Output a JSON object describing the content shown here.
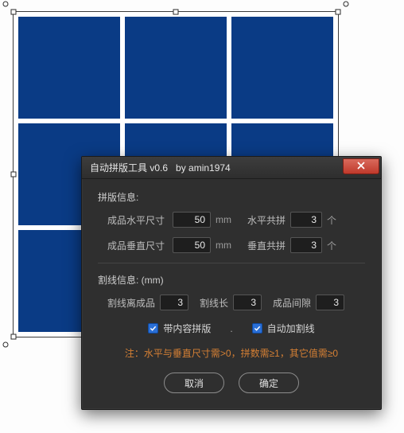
{
  "canvas": {
    "grid_rows": 3,
    "grid_cols": 3,
    "cell_color": "#0a3b85"
  },
  "dialog": {
    "title": "自动拼版工具 v0.6   by amin1974",
    "section1_title": "拼版信息:",
    "row_h": {
      "label": "成品水平尺寸",
      "value": "50",
      "unit": "mm",
      "label2": "水平共拼",
      "value2": "3",
      "unit2": "个"
    },
    "row_v": {
      "label": "成品垂直尺寸",
      "value": "50",
      "unit": "mm",
      "label2": "垂直共拼",
      "value2": "3",
      "unit2": "个"
    },
    "section2_title": "割线信息: (mm)",
    "cut": {
      "label_offset": "割线离成品",
      "value_offset": "3",
      "label_len": "割线长",
      "value_len": "3",
      "label_gap": "成品间隙",
      "value_gap": "3"
    },
    "checks": {
      "with_content": {
        "label": "带内容拼版",
        "checked": true
      },
      "separator": ".",
      "auto_cut": {
        "label": "自动加割线",
        "checked": true
      }
    },
    "note": "注：水平与垂直尺寸需>0，拼数需≥1，其它值需≥0",
    "buttons": {
      "cancel": "取消",
      "ok": "确定"
    }
  }
}
